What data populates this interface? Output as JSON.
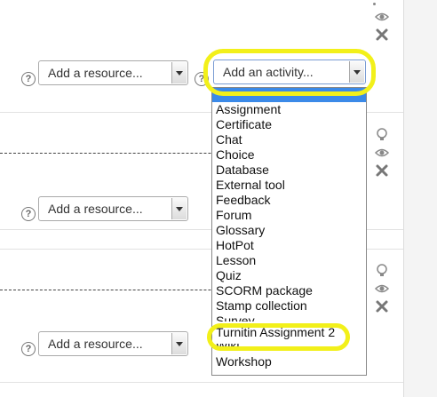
{
  "sections": [
    {
      "resource_select": "Add a resource...",
      "help": "?"
    },
    {
      "resource_select": "Add a resource...",
      "help": "?"
    },
    {
      "resource_select": "Add a resource...",
      "help": "?"
    }
  ],
  "activity_select": {
    "label": "Add an activity...",
    "help": "?"
  },
  "activity_options": [
    "Assignment",
    "Certificate",
    "Chat",
    "Choice",
    "Database",
    "External tool",
    "Feedback",
    "Forum",
    "Glossary",
    "HotPot",
    "Lesson",
    "Quiz",
    "SCORM package",
    "Stamp collection",
    "Survey",
    "Turnitin Assignment 2",
    "Wiki",
    "Workshop"
  ],
  "highlight_color": "#f2f01a",
  "icons": [
    "lightbulb-icon",
    "eye-icon",
    "delete-icon",
    "help-icon",
    "chevron-down-icon"
  ]
}
